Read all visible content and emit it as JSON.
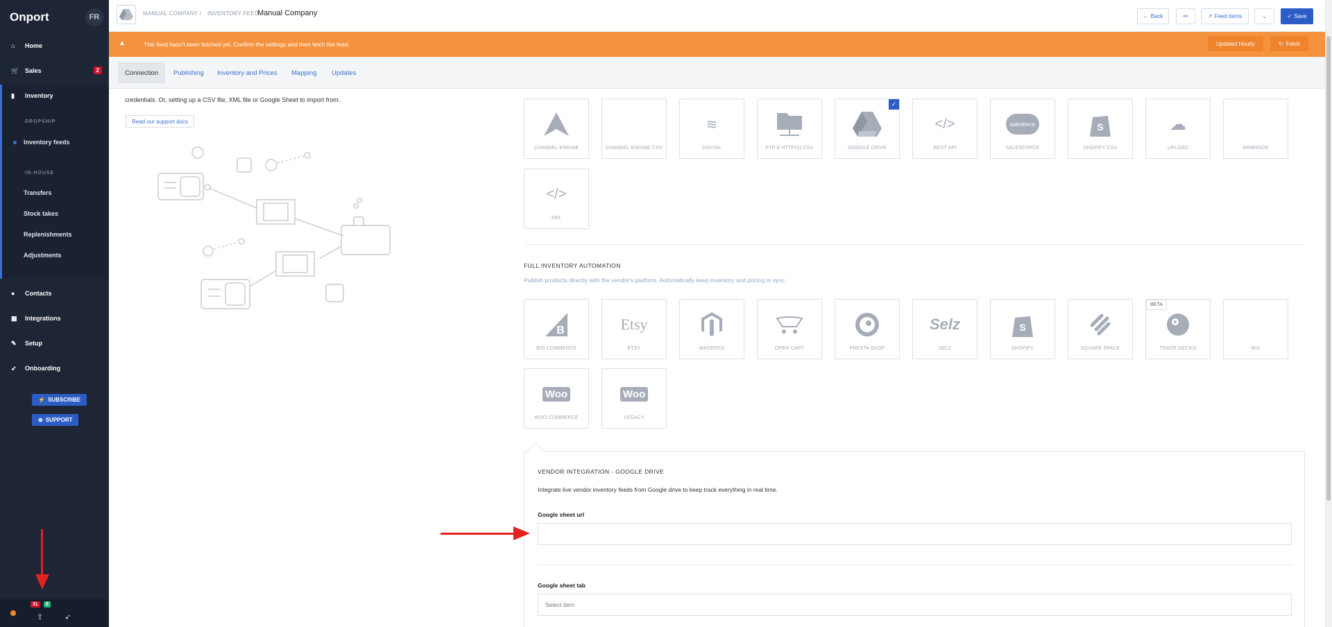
{
  "sidebar": {
    "brand": "Onport",
    "lang": "FR",
    "items": [
      {
        "label": "Home",
        "icon": "home-icon"
      },
      {
        "label": "Sales",
        "icon": "cart-icon",
        "badge": "2"
      },
      {
        "label": "Inventory",
        "icon": "bookmark-icon"
      },
      {
        "label": "Contacts",
        "icon": "user-icon"
      },
      {
        "label": "Integrations",
        "icon": "grid-icon"
      },
      {
        "label": "Setup",
        "icon": "wrench-icon"
      },
      {
        "label": "Onboarding",
        "icon": "rocket-icon"
      }
    ],
    "dropship_label": "DROPSHIP",
    "inventory_feeds": "Inventory feeds",
    "inhouse_label": "IN-HOUSE",
    "inhouse_items": [
      "Transfers",
      "Stock takes",
      "Replenishments",
      "Adjustments"
    ],
    "subscribe": "SUBSCRIBE",
    "support": "SUPPORT",
    "bottom_badge_red": "31",
    "bottom_badge_green": "8"
  },
  "header": {
    "crumb1": "MANUAL COMPANY",
    "crumb_sep": "/",
    "crumb2": "INVENTORY FEED",
    "title": "Manual Company",
    "back": "Back",
    "feed_items": "Feed items",
    "save": "Save"
  },
  "alert": {
    "message": "This feed hasn't been fetched yet. Confirm the settings and then fetch the feed.",
    "updated": "Updated Hourly",
    "fetch": "Fetch"
  },
  "tabs": [
    "Connection",
    "Publishing",
    "Inventory and Prices",
    "Mapping",
    "Updates"
  ],
  "left": {
    "intro": "credentials. Or, setting up a CSV file, XML file or Google Sheet to import from.",
    "docs_button": "Read our support docs"
  },
  "sources": [
    {
      "label": "CHANNEL ENGINE",
      "icon": "channel-engine-icon"
    },
    {
      "label": "CHANNEL ENGINE CSV",
      "icon": "blank-icon"
    },
    {
      "label": "DIGITAL",
      "icon": "wifi-icon"
    },
    {
      "label": "FTP & HTTP(S) CSV",
      "icon": "folder-network-icon"
    },
    {
      "label": "GOOGLE DRIVE",
      "icon": "google-drive-icon",
      "selected": true
    },
    {
      "label": "REST API",
      "icon": "code-icon"
    },
    {
      "label": "SALESFORCE",
      "icon": "salesforce-icon"
    },
    {
      "label": "SHOPIFY CSV",
      "icon": "shopify-icon"
    },
    {
      "label": "UPLOAD",
      "icon": "cloud-upload-icon"
    },
    {
      "label": "WEBHOOK",
      "icon": "blank-icon"
    },
    {
      "label": "XML",
      "icon": "code-icon"
    }
  ],
  "automation": {
    "title": "FULL INVENTORY AUTOMATION",
    "desc": "Publish products directly with the vendor's platform. Automatically keep inventory and pricing in sync.",
    "platforms": [
      {
        "label": "BIG COMMERCE",
        "icon": "bigcommerce-icon"
      },
      {
        "label": "ETSY",
        "icon": "etsy-icon"
      },
      {
        "label": "MAGENTO",
        "icon": "magento-icon"
      },
      {
        "label": "OPEN CART",
        "icon": "cart-icon"
      },
      {
        "label": "PRESTA SHOP",
        "icon": "prestashop-icon"
      },
      {
        "label": "SELZ",
        "icon": "selz-icon"
      },
      {
        "label": "SHOPIFY",
        "icon": "shopify-icon"
      },
      {
        "label": "SQUARE SPACE",
        "icon": "squarespace-icon"
      },
      {
        "label": "TRADE GECKO",
        "icon": "tradegecko-icon",
        "beta": "BETA"
      },
      {
        "label": "WIX",
        "icon": "blank-icon"
      },
      {
        "label": "WOO COMMERCE",
        "icon": "woo-icon"
      },
      {
        "label": "LEGACY",
        "icon": "woo-icon"
      }
    ],
    "etsy_text": "Etsy",
    "selz_text": "Selz",
    "woo_text": "Woo",
    "salesforce_text": "salesforce"
  },
  "vendor": {
    "title": "VENDOR INTEGRATION - GOOGLE DRIVE",
    "desc": "Integrate live vendor inventory feeds from Google drive to keep track everything in real time.",
    "url_label": "Google sheet url",
    "url_value": "",
    "tab_label": "Google sheet tab",
    "tab_placeholder": "Select item"
  },
  "colors": {
    "sidebar": "#1e2635",
    "accent": "#2c5cc5",
    "alert": "#f5923e",
    "annotation": "#e3211f"
  }
}
